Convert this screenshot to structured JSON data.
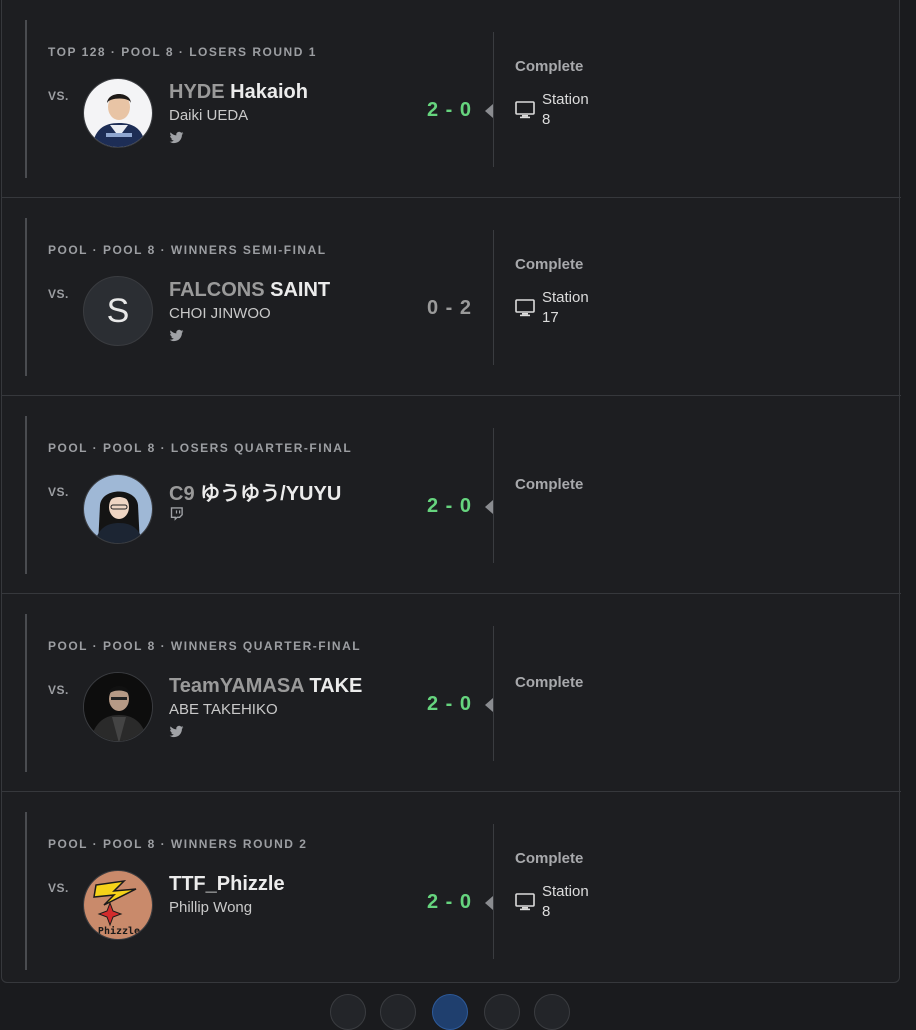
{
  "matches": [
    {
      "round": "TOP 128 · POOL 8 · LOSERS ROUND 1",
      "vs": "VS.",
      "prefix": "HYDE",
      "gamertag": "Hakaioh",
      "real_name": "Daiki UEDA",
      "social": "twitter-icon",
      "score": "2 - 0",
      "result": "win",
      "status": "Complete",
      "station": "Station",
      "station_number": "8"
    },
    {
      "round": "POOL · POOL 8 · WINNERS SEMI-FINAL",
      "vs": "VS.",
      "prefix": "FALCONS",
      "gamertag": "SAINT",
      "avatar_initial": "S",
      "real_name": "CHOI JINWOO",
      "social": "twitter-icon",
      "score": "0 - 2",
      "result": "loss",
      "status": "Complete",
      "station": "Station",
      "station_number": "17"
    },
    {
      "round": "POOL · POOL 8 · LOSERS QUARTER-FINAL",
      "vs": "VS.",
      "prefix": "C9",
      "gamertag": "ゆうゆう/YUYU",
      "social": "twitch-icon",
      "score": "2 - 0",
      "result": "win",
      "status": "Complete"
    },
    {
      "round": "POOL · POOL 8 · WINNERS QUARTER-FINAL",
      "vs": "VS.",
      "prefix": "TeamYAMASA",
      "gamertag": "TAKE",
      "real_name": "ABE TAKEHIKO",
      "social": "twitter-icon",
      "score": "2 - 0",
      "result": "win",
      "status": "Complete"
    },
    {
      "round": "POOL · POOL 8 · WINNERS ROUND 2",
      "vs": "VS.",
      "gamertag": "TTF_Phizzle",
      "real_name": "Phillip Wong",
      "avatar_text": "Phizzle",
      "score": "2 - 0",
      "result": "win",
      "status": "Complete",
      "station": "Station",
      "station_number": "8"
    }
  ],
  "colors": {
    "win": "#66d47e",
    "loss": "#9a9a9a",
    "background": "#1d1e21",
    "accent": "#1f3f6e"
  }
}
